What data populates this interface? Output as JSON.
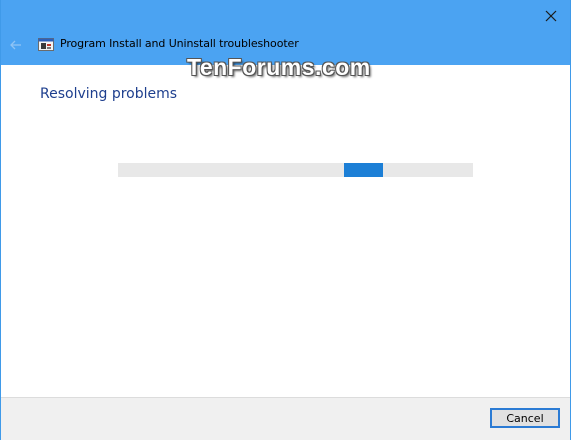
{
  "window": {
    "title": "Program Install and Uninstall troubleshooter",
    "accent_color": "#4ba3f2",
    "close_icon": "close-icon",
    "back_icon": "back-arrow-icon",
    "app_icon": "troubleshooter-icon"
  },
  "watermark": {
    "text": "TenForums.com"
  },
  "content": {
    "heading": "Resolving problems",
    "progress": {
      "mode": "indeterminate",
      "bar_color": "#1c7fd6"
    }
  },
  "footer": {
    "cancel_label": "Cancel"
  }
}
